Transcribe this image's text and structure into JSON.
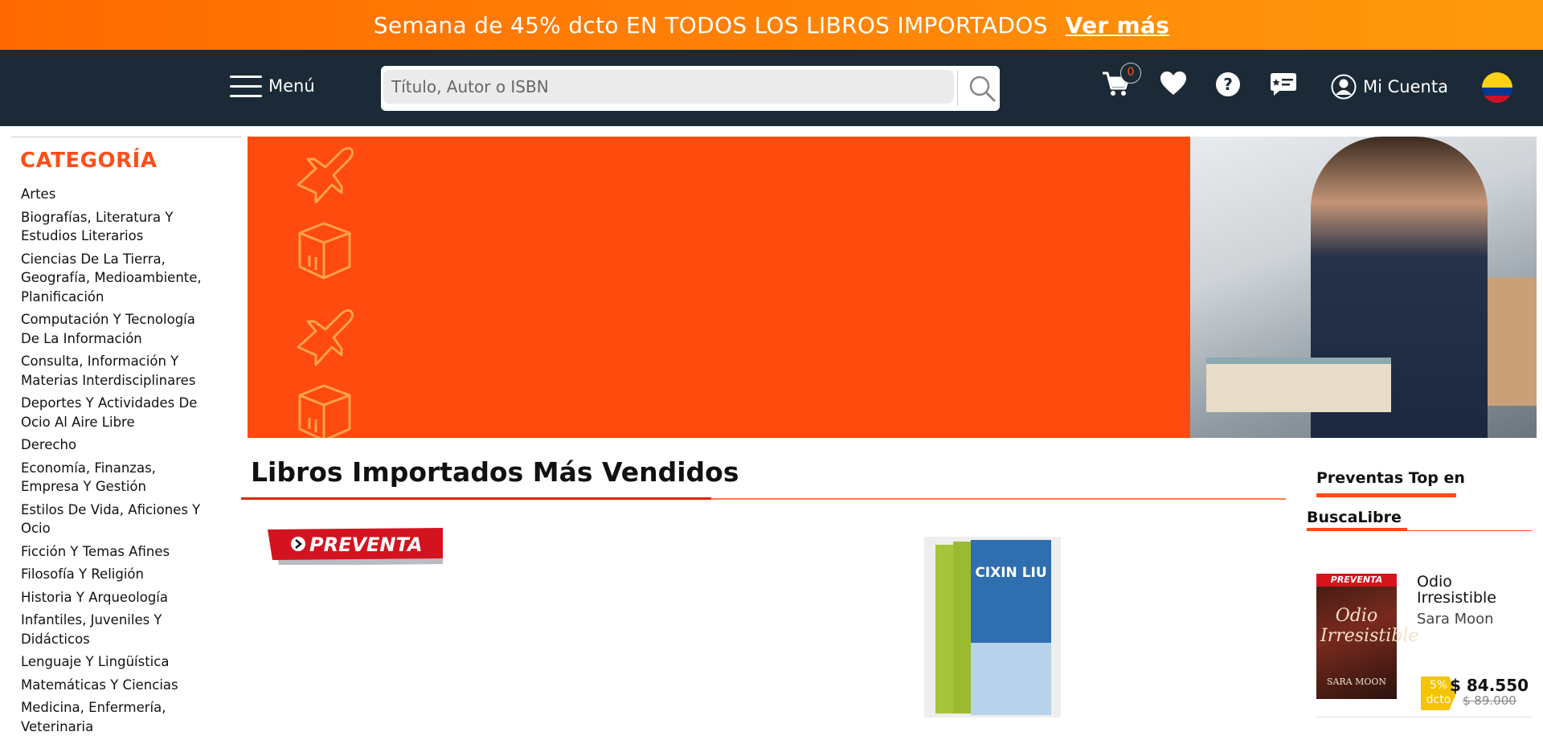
{
  "promo": {
    "text": "Semana de 45% dcto EN TODOS LOS LIBROS IMPORTADOS",
    "link": "Ver más"
  },
  "nav": {
    "menu_label": "Menú",
    "search_placeholder": "Título, Autor o ISBN",
    "cart_count": "0",
    "account_label": "Mi Cuenta"
  },
  "sidebar": {
    "title": "CATEGORÍA",
    "categories": [
      "Artes",
      "Biografías, Literatura Y Estudios Literarios",
      "Ciencias De La Tierra, Geografía, Medioambiente, Planificación",
      "Computación Y Tecnología De La Información",
      "Consulta, Información Y Materias Interdisciplinares",
      "Deportes Y Actividades De Ocio Al Aire Libre",
      "Derecho",
      "Economía, Finanzas, Empresa Y Gestión",
      "Estilos De Vida, Aficiones Y Ocio",
      "Ficción Y Temas Afines",
      "Filosofía Y Religión",
      "Historia Y Arqueología",
      "Infantiles, Juveniles Y Didácticos",
      "Lenguaje Y Lingüística",
      "Matemáticas Y Ciencias",
      "Medicina, Enfermería, Veterinaria"
    ]
  },
  "main": {
    "section_title": "Libros Importados Más Vendidos",
    "preventa_label": "PREVENTA",
    "book_cover_title": "CIXIN LIU"
  },
  "right": {
    "heading_line1": "Preventas Top en",
    "heading_line2": "BuscaLibre",
    "product": {
      "badge": "PREVENTA",
      "cover_title": "Odio Irresistible",
      "cover_author": "SARA MOON",
      "title": "Odio Irresistible",
      "author": "Sara Moon",
      "discount_pct": "5%",
      "discount_word": "dcto",
      "price": "$ 84.550",
      "old_price": "$ 89.000"
    }
  },
  "colors": {
    "accent": "#ff4b0d",
    "nav_bg": "#1b2a36",
    "promo_start": "#ff6a00",
    "promo_end": "#ff9a0c",
    "badge_yellow": "#f5c400"
  }
}
